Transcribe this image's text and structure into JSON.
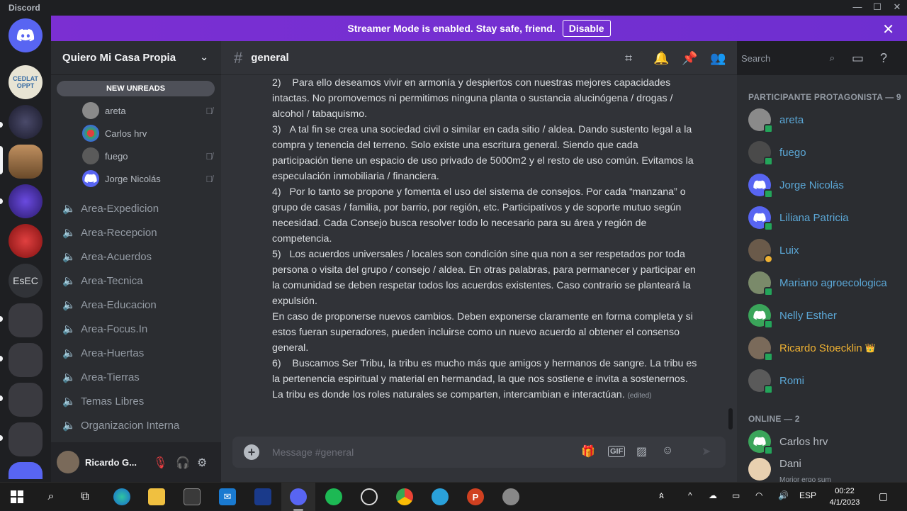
{
  "window": {
    "app_title": "Discord",
    "minimize": "—",
    "maximize": "☐",
    "close": "✕"
  },
  "banner": {
    "text": "Streamer Mode is enabled. Stay safe, friend.",
    "button": "Disable",
    "close": "✕"
  },
  "servers": [
    {
      "label": "",
      "bg": "#5865f2",
      "icon": "discord-home-icon"
    },
    {
      "label": "CEDLAT OPPT",
      "bg": "#e8e4d4",
      "fg": "#3a6ea5"
    },
    {
      "label": "",
      "bg": "#2a2a3a"
    },
    {
      "label": "",
      "bg": "#8a5a3a"
    },
    {
      "label": "",
      "bg": "#3a2a8a"
    },
    {
      "label": "",
      "bg": "#b02020"
    },
    {
      "label": "EsEC",
      "bg": "#313338"
    },
    {
      "label": "",
      "bg": "#3a3a40"
    },
    {
      "label": "",
      "bg": "#3a3a40"
    },
    {
      "label": "",
      "bg": "#3a3a40"
    },
    {
      "label": "",
      "bg": "#3a3a40"
    }
  ],
  "guild": {
    "name": "Quiero Mi Casa Propia",
    "chevron": "⌄",
    "new_unreads": "NEW UNREADS"
  },
  "voice_users": [
    {
      "name": "areta",
      "av": "#8a8a8a",
      "muted": true
    },
    {
      "name": "Carlos hrv",
      "av": "#3aa55a",
      "muted": false
    },
    {
      "name": "fuego",
      "av": "#5a5a5a",
      "muted": true
    },
    {
      "name": "Jorge Nicolás",
      "av": "#5865f2",
      "muted": true
    }
  ],
  "channels": [
    {
      "name": "Area-Expedicion",
      "icon": "🔈"
    },
    {
      "name": "Area-Recepcion",
      "icon": "🔈"
    },
    {
      "name": "Area-Acuerdos",
      "icon": "🔈"
    },
    {
      "name": "Area-Tecnica",
      "icon": "🔈"
    },
    {
      "name": "Area-Educacion",
      "icon": "🔈"
    },
    {
      "name": "Area-Focus.In",
      "icon": "🔈"
    },
    {
      "name": "Area-Huertas",
      "icon": "🔈"
    },
    {
      "name": "Area-Tierras",
      "icon": "🔈"
    },
    {
      "name": "Temas Libres",
      "icon": "🔈"
    },
    {
      "name": "Organizacion Interna",
      "icon": "🔈"
    }
  ],
  "user": {
    "name": "Ricardo G...",
    "mic": "🎙",
    "headset": "🎧",
    "settings": "⚙"
  },
  "channel": {
    "hash": "#",
    "name": "general",
    "search_placeholder": "Search"
  },
  "messages": [
    "2)    Para ello deseamos vivir en armonía y despiertos con nuestras mejores capacidades intactas. No promovemos ni permitimos ninguna planta o sustancia alucinógena / drogas / alcohol / tabaquismo.",
    "3)   A tal fin se crea una sociedad civil o similar en cada sitio / aldea. Dando sustento legal a la compra y tenencia del terreno. Solo existe una escritura general. Siendo que cada participación tiene un espacio de uso privado de 5000m2 y el resto de uso común. Evitamos la especulación inmobiliaria / financiera.",
    "4)   Por lo tanto se propone y fomenta el uso del sistema de consejos. Por cada “manzana” o grupo de casas / familia, por barrio, por región, etc. Participativos y de soporte mutuo según necesidad. Cada Consejo busca resolver todo lo necesario para su área y región de competencia.",
    "5)   Los acuerdos universales / locales son condición sine qua non a ser respetados por toda persona o visita del grupo / consejo / aldea. En otras palabras, para permanecer y participar en la comunidad se deben respetar todos los acuerdos existentes. Caso contrario se planteará la expulsión.",
    "En caso de proponerse nuevos cambios. Deben exponerse claramente en forma completa y si estos fueran superadores, pueden incluirse como un nuevo acuerdo al obtener el consenso general.",
    "6)    Buscamos Ser Tribu, la tribu es mucho más que amigos y hermanos de sangre. La tribu es la pertenencia espiritual y material en hermandad, la que nos sostiene e invita a sostenernos. La tribu es donde los roles naturales se comparten, intercambian e interactúan."
  ],
  "edited_label": "(edited)",
  "composer": {
    "placeholder": "Message #general",
    "gif": "GIF"
  },
  "member_groups": [
    {
      "title": "PARTICIPANTE PROTAGONISTA — 9",
      "color": "#5ba7d6"
    },
    {
      "title": "ONLINE — 2"
    }
  ],
  "members": [
    {
      "name": "areta",
      "color": "#5ba7d6",
      "av": "#8a8a8a",
      "status": "online"
    },
    {
      "name": "fuego",
      "color": "#5ba7d6",
      "av": "#4a4a4a",
      "status": "online"
    },
    {
      "name": "Jorge Nicolás",
      "color": "#5ba7d6",
      "av": "discord",
      "status": "online"
    },
    {
      "name": "Liliana Patricia",
      "color": "#5ba7d6",
      "av": "discord",
      "status": "online"
    },
    {
      "name": "Luix",
      "color": "#5ba7d6",
      "av": "#6a5a4a",
      "status": "idle"
    },
    {
      "name": "Mariano agroecologica",
      "color": "#5ba7d6",
      "av": "#7a8a6a",
      "status": "online"
    },
    {
      "name": "Nelly Esther",
      "color": "#5ba7d6",
      "av": "#3aa55a",
      "status": "online"
    },
    {
      "name": "Ricardo Stoecklin",
      "color": "#f0b232",
      "av": "#7a6a5a",
      "status": "online",
      "crown": "👑"
    },
    {
      "name": "Romi",
      "color": "#5ba7d6",
      "av": "#5a5a5a",
      "status": "online"
    },
    {
      "name": "Carlos hrv",
      "color": "#b5bac1",
      "av": "#3aa55a",
      "status": "online"
    },
    {
      "name": "Dani",
      "color": "#b5bac1",
      "av": "#e8d0b0",
      "status": "online",
      "sub": "Morior ergo sum"
    }
  ],
  "taskbar": {
    "lang": "ESP",
    "time": "00:22",
    "date": "4/1/2023"
  }
}
